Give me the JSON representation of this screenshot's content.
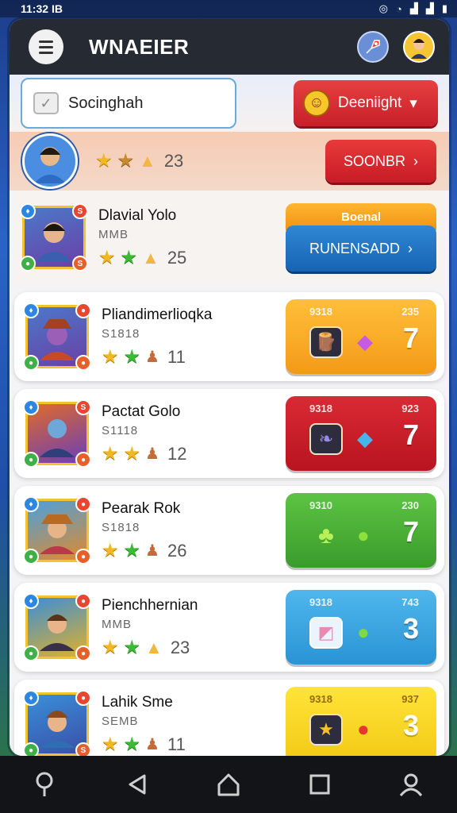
{
  "status": {
    "time": "11:32",
    "sim": "IB"
  },
  "app": {
    "title": "WNAEIER"
  },
  "search": {
    "text": "Socinghah"
  },
  "header_button": {
    "label": "Deeniight"
  },
  "me": {
    "value": "23",
    "button": "SOONBR"
  },
  "players": [
    {
      "name": "Dlavial Yolo",
      "sub": "MMB",
      "stars": [
        "gold",
        "green"
      ],
      "extra": "tri",
      "value": "25",
      "action": {
        "top": "Boenal",
        "button": "RUNENSADD"
      }
    },
    {
      "name": "Pliandimerlioqka",
      "sub": "S1818",
      "stars": [
        "gold",
        "green"
      ],
      "extra": "bell",
      "value": "11",
      "card": {
        "color": "orange",
        "label_left": "9318",
        "label_right": "235",
        "value": "7",
        "item": "log",
        "gem": "purple"
      }
    },
    {
      "name": "Pactat Golo",
      "sub": "S1118",
      "stars": [
        "gold",
        "gold"
      ],
      "extra": "bell",
      "value": "12",
      "card": {
        "color": "red",
        "label_left": "9318",
        "label_right": "923",
        "value": "7",
        "item": "feather",
        "gem": "blue"
      }
    },
    {
      "name": "Pearak Rok",
      "sub": "S1818",
      "stars": [
        "gold",
        "green"
      ],
      "extra": "bell",
      "value": "26",
      "card": {
        "color": "green",
        "label_left": "9310",
        "label_right": "230",
        "value": "7",
        "item": "leaf",
        "gem": "green"
      }
    },
    {
      "name": "Pienchhernian",
      "sub": "MMB",
      "stars": [
        "gold",
        "green"
      ],
      "extra": "tri",
      "value": "23",
      "card": {
        "color": "cyan",
        "label_left": "9318",
        "label_right": "743",
        "value": "3",
        "item": "cloth",
        "gem": "green"
      }
    },
    {
      "name": "Lahik Sme",
      "sub": "SEMB",
      "stars": [
        "gold",
        "green"
      ],
      "extra": "bell",
      "value": "11",
      "card": {
        "color": "yellow",
        "label_left": "9318",
        "label_right": "937",
        "value": "3",
        "item": "star",
        "gem": "red"
      }
    }
  ]
}
